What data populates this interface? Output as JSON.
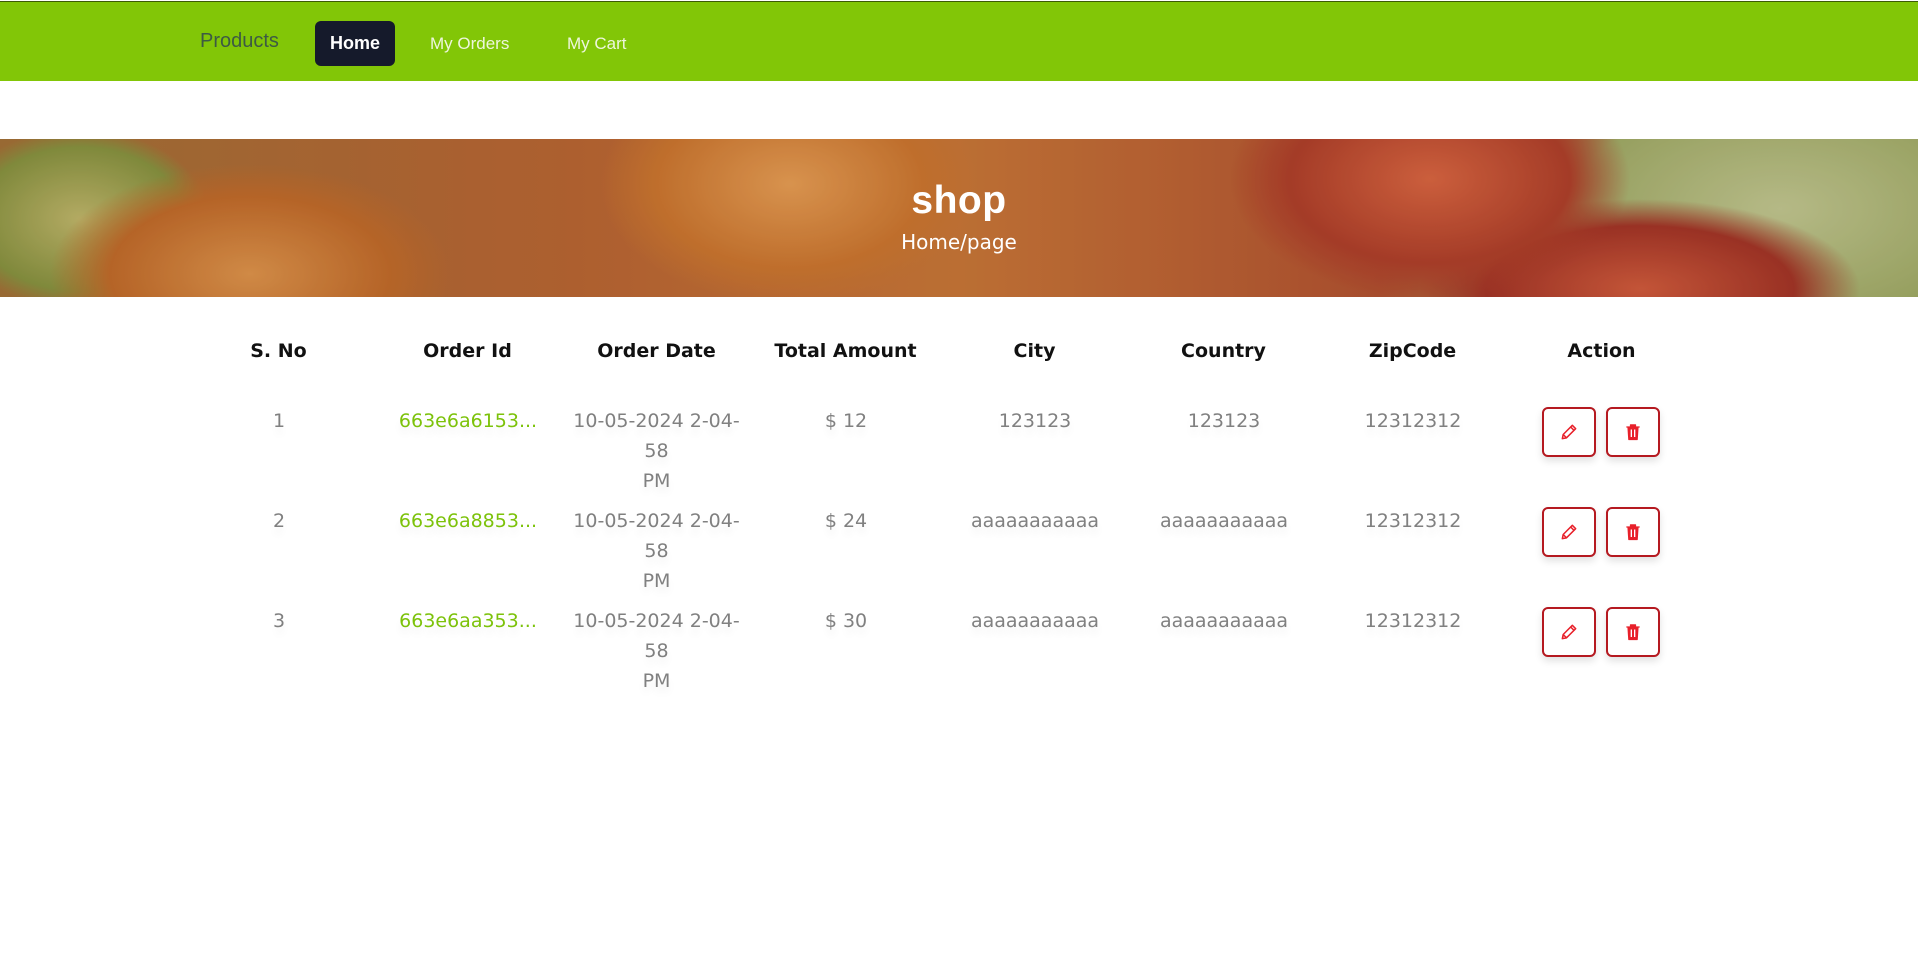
{
  "navbar": {
    "brand": "Products",
    "links": [
      {
        "label": "Home",
        "active": true
      },
      {
        "label": "My Orders",
        "active": false
      },
      {
        "label": "My Cart",
        "active": false
      }
    ],
    "bg_color": "#82c607"
  },
  "banner": {
    "title": "shop",
    "breadcrumb": "Home/page"
  },
  "table": {
    "headers": [
      "S. No",
      "Order Id",
      "Order Date",
      "Total Amount",
      "City",
      "Country",
      "ZipCode",
      "Action"
    ],
    "rows": [
      {
        "sno": "1",
        "order_id": "663e6a6153...",
        "date_line1": "10-05-2024 2-04-58",
        "date_line2": "PM",
        "amount": "$ 12",
        "city": "123123",
        "country": "123123",
        "zip": "12312312"
      },
      {
        "sno": "2",
        "order_id": "663e6a8853...",
        "date_line1": "10-05-2024 2-04-58",
        "date_line2": "PM",
        "amount": "$ 24",
        "city": "aaaaaaaaaaa",
        "country": "aaaaaaaaaaa",
        "zip": "12312312"
      },
      {
        "sno": "3",
        "order_id": "663e6aa353...",
        "date_line1": "10-05-2024 2-04-58",
        "date_line2": "PM",
        "amount": "$ 30",
        "city": "aaaaaaaaaaa",
        "country": "aaaaaaaaaaa",
        "zip": "12312312"
      }
    ],
    "actions": {
      "edit_icon": "pencil-icon",
      "delete_icon": "trash-icon"
    },
    "accent_color": "#7cc20a",
    "danger_color": "#b51920"
  }
}
